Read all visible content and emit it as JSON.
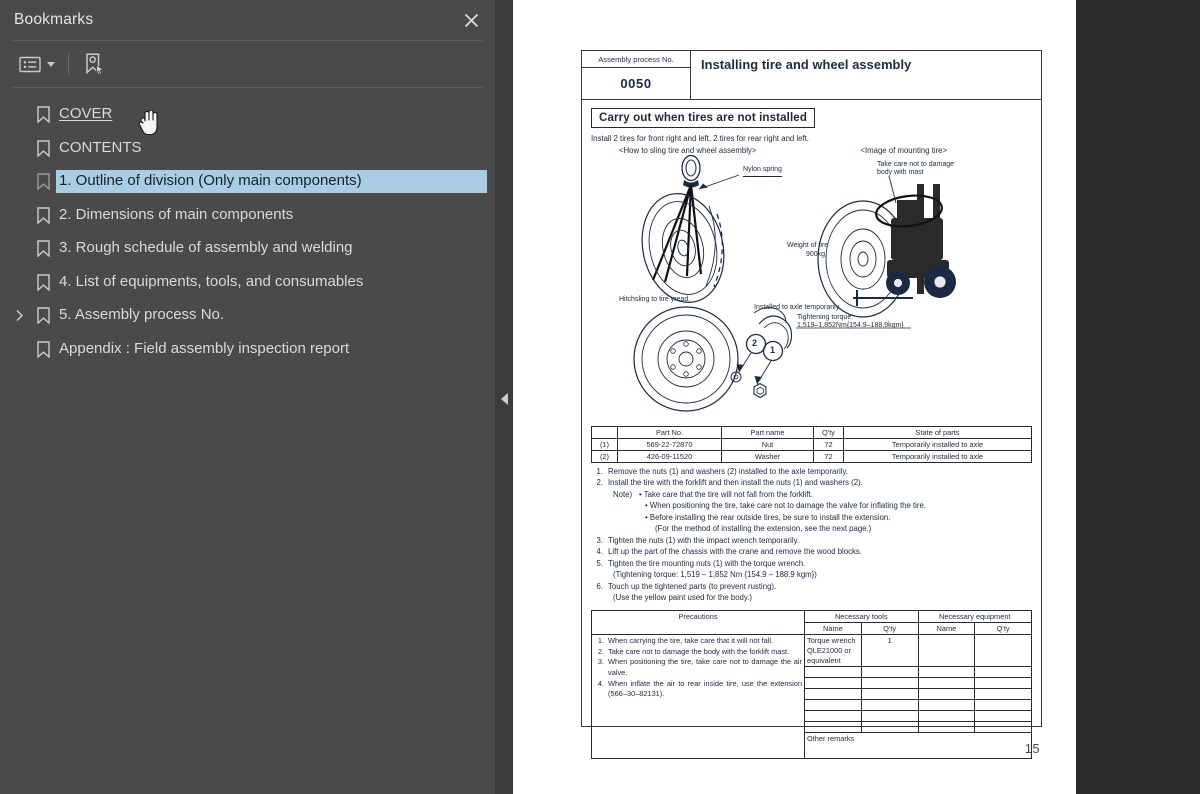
{
  "sidebar": {
    "title": "Bookmarks",
    "close_icon": "close-icon",
    "toolbar": {
      "options_icon": "list-options-icon",
      "caret_icon": "chevron-down-icon",
      "find_bookmark_icon": "select-bookmark-icon"
    },
    "items": [
      {
        "label": "COVER",
        "selected": false,
        "link": true,
        "expandable": false
      },
      {
        "label": "CONTENTS",
        "selected": false,
        "link": false,
        "expandable": false
      },
      {
        "label": "1. Outline of division (Only main components)",
        "selected": true,
        "link": false,
        "expandable": false
      },
      {
        "label": "2. Dimensions of main components",
        "selected": false,
        "link": false,
        "expandable": false
      },
      {
        "label": "3. Rough schedule of assembly and welding",
        "selected": false,
        "link": false,
        "expandable": false
      },
      {
        "label": "4. List of equipments, tools, and consumables",
        "selected": false,
        "link": false,
        "expandable": false
      },
      {
        "label": "5. Assembly process No.",
        "selected": false,
        "link": false,
        "expandable": true
      },
      {
        "label": "Appendix : Field assembly inspection report",
        "selected": false,
        "link": false,
        "expandable": false
      }
    ]
  },
  "viewer": {
    "collapse_handle_icon": "triangle-left-icon",
    "page_number": "15"
  },
  "document": {
    "header": {
      "process_no_label": "Assembly process No.",
      "process_no_value": "0050",
      "title": "Installing tire and wheel assembly"
    },
    "callout_box": "Carry out when tires are not installed",
    "intro_line": "Install 2 tires for front right and left, 2 tires for rear right and left.",
    "fig_caption_left": "<How to sling tire and wheel assembly>",
    "fig_caption_right": "<Image of mounting tire>",
    "figure_labels": {
      "nylon_spring": "Nylon spring",
      "weight_line1": "Weight of tire",
      "weight_line2": "900kg",
      "hitchsling": "Hitchsling to tire yread.",
      "mast_warn_line1": "Take care not to damage",
      "mast_warn_line2": "body with mast",
      "installed_axle": "Installed to axle temporarily",
      "torque_line1": "Tightening torque:",
      "torque_line2": "1,519–1,852Nm{154.9–188.9kgm}",
      "balloon_1": "1",
      "balloon_2": "2"
    },
    "parts_table": {
      "headers": [
        "",
        "Part No.",
        "Part name",
        "Q'ty",
        "State of parts"
      ],
      "rows": [
        [
          "(1)",
          "569-22-72870",
          "Nut",
          "72",
          "Temporarily installed to axle"
        ],
        [
          "(2)",
          "426-09-11520",
          "Washer",
          "72",
          "Temporarily installed to axle"
        ]
      ]
    },
    "steps": [
      {
        "n": "1.",
        "text": "Remove the nuts (1) and washers (2) installed to the axle temporarily."
      },
      {
        "n": "2.",
        "text": "Install the tire with the forklift and then install the nuts (1) and washers (2)."
      },
      {
        "n": "3.",
        "text": "Tighten the nuts (1) with the impact wrench temporarily."
      },
      {
        "n": "4.",
        "text": "Lift up the part of the chassis with the crane and remove the wood blocks."
      },
      {
        "n": "5.",
        "text": "Tighten the tire mounting nuts (1) with the torque wrench."
      },
      {
        "n": "6.",
        "text": "Touch up the tightened parts (to prevent rusting)."
      }
    ],
    "notes": {
      "label": "Note)",
      "bullet1": "• Take care that the tire will not fall from the forklift.",
      "bullet2": "• When positioning the tire, take care not to damage the valve for inflating the tire.",
      "bullet3": "• Before installing the rear outside tires, be sure to install the extension.",
      "bullet3_cont": "(For the method of installing the extension, see the next page.)"
    },
    "step5_cont": "(Tightening torque: 1,519 – 1,852 Nm {154.9 – 188.9 kgm})",
    "step6_cont": "(Use the yellow paint used for the body.)",
    "bottom_table": {
      "precautions_header": "Precautions",
      "tools_header": "Necessary tools",
      "equipment_header": "Necessary equipment",
      "name_header": "Name",
      "qty_header": "Q'ty",
      "precautions": [
        {
          "n": "1.",
          "text": "When carrying the tire, take care that it will not fall."
        },
        {
          "n": "2.",
          "text": "Take care not to damage the body with the forklift mast."
        },
        {
          "n": "3.",
          "text": "When positioning the tire, take care not to damage the air valve."
        },
        {
          "n": "4.",
          "text": "When inflate the air to rear inside tire, use the extension (566–30–82131)."
        }
      ],
      "tool_rows": [
        {
          "name": "Torque wrench\nQLE21000 or equivalent",
          "qty": "1"
        },
        {
          "name": "",
          "qty": ""
        },
        {
          "name": "",
          "qty": ""
        },
        {
          "name": "",
          "qty": ""
        },
        {
          "name": "",
          "qty": ""
        },
        {
          "name": "",
          "qty": ""
        },
        {
          "name": "",
          "qty": ""
        }
      ],
      "equipment_rows": [
        {
          "name": "",
          "qty": ""
        },
        {
          "name": "",
          "qty": ""
        },
        {
          "name": "",
          "qty": ""
        },
        {
          "name": "",
          "qty": ""
        },
        {
          "name": "",
          "qty": ""
        },
        {
          "name": "",
          "qty": ""
        },
        {
          "name": "",
          "qty": ""
        }
      ],
      "other_remarks": "Other remarks"
    }
  },
  "colors": {
    "sidebar_bg": "#4a4a4a",
    "viewer_bg": "#2b2b2b",
    "selection": "#a8cde4",
    "page_bg": "#ffffff",
    "doc_text": "#1b2a44"
  }
}
